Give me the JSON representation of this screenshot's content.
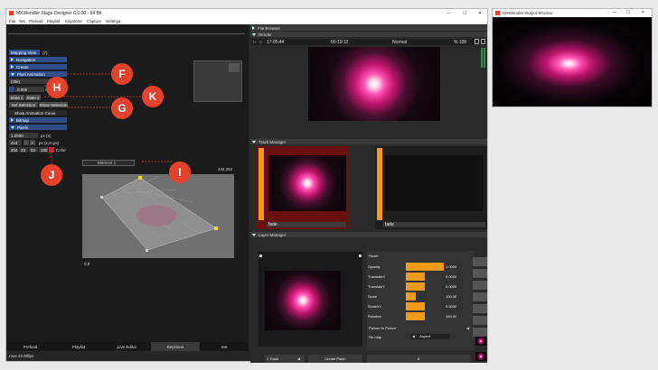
{
  "app": {
    "title": "MXWendler Stage Designer 6.0.00 - 64 Bit"
  },
  "menu": [
    "File",
    "Set",
    "Preload",
    "Playlist",
    "Keystone",
    "Capture",
    "Settings"
  ],
  "left": {
    "mapping_view": "Mapping View",
    "mapping_count": "(7)",
    "rows": [
      "Navigation",
      "Create",
      "Pixel Animation"
    ],
    "title_field": "(title)",
    "value_field": "0.000",
    "state_label": "State",
    "state1": "State 1",
    "state2": "State 2",
    "set_selection": "Set Selection",
    "show_selection": "Show Selection",
    "show_curve": "Show Animation Curve",
    "bitmap": "Bitmap",
    "pixels": "Pixels",
    "px_value": "1.0000",
    "px_unit": "px (x)",
    "grid_value": "4x4",
    "grid_unit": "px (x,m px)",
    "rgba": [
      "204",
      "33",
      "53",
      "255"
    ],
    "color_label": "Color",
    "element_label": "Element 1",
    "coord_top": "444,261",
    "coord_bottom": "0,0"
  },
  "callouts": [
    "F",
    "H",
    "K",
    "G",
    "I",
    "J"
  ],
  "tabs": [
    "Preload",
    "Playlist",
    "Live Editor",
    "Keystone",
    "Set"
  ],
  "status": ".mxe 24.00fps",
  "right": {
    "file_browser": "File Browser",
    "render": "Render",
    "time_elapsed": "17:05:44",
    "time_remaining": "00:19:12",
    "mode": "Normal",
    "percent": "% 100",
    "track_manager": "Track Manager",
    "track1_name": "fade",
    "track2_name": "fade",
    "layer_manager": "Layer Manager",
    "reset": "Reset",
    "props": [
      {
        "label": "Opacity",
        "value": "1.0000",
        "fill": 1.0
      },
      {
        "label": "TranslateX",
        "value": "0.0000",
        "fill": 0.5
      },
      {
        "label": "TranslateY",
        "value": "0.0000",
        "fill": 0.5
      },
      {
        "label": "Scale",
        "value": "100.00",
        "fill": 0.25
      },
      {
        "label": "ScaleXY",
        "value": "0.5000",
        "fill": 0.5
      },
      {
        "label": "Rotation",
        "value": "180.00",
        "fill": 0.5
      }
    ],
    "pip": "Picture In Picture",
    "remap": "Re-map",
    "remap_value": "Aspect",
    "track_select": "1 Track",
    "create_patch": "Create Patch",
    "number_field": "8"
  },
  "output": {
    "title": "MXWendler Output Window"
  },
  "colors": {
    "accent": "#f39a18",
    "panel_blue": "#2f4f8c",
    "callout": "#e3432d",
    "track_red": "#6b1010"
  }
}
